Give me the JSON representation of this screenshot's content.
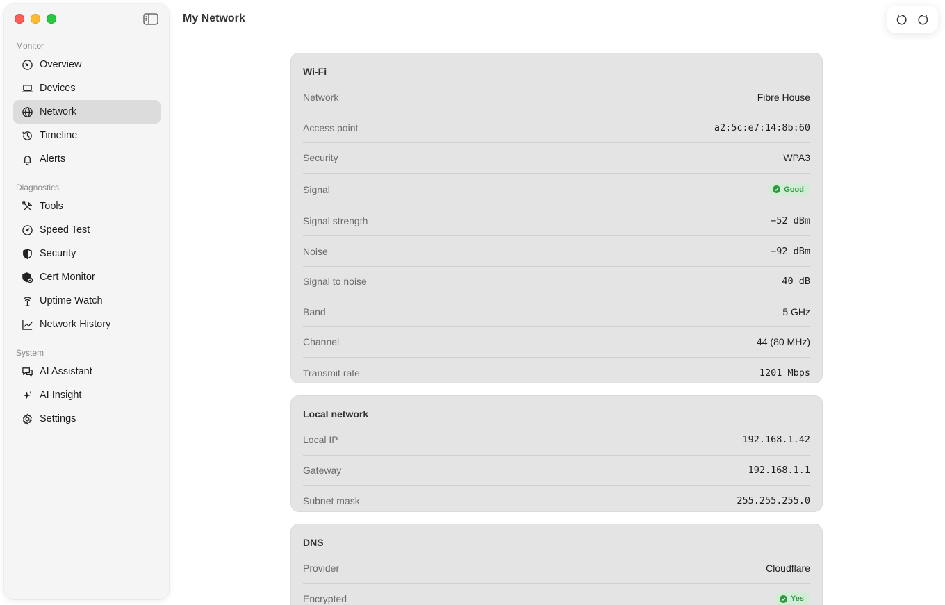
{
  "window": {
    "title": "My Network"
  },
  "sidebar": {
    "sections": [
      {
        "label": "Monitor"
      },
      {
        "label": "Diagnostics"
      },
      {
        "label": "System"
      }
    ],
    "items": [
      {
        "label": "Overview",
        "icon": "gauge-icon"
      },
      {
        "label": "Devices",
        "icon": "laptop-icon"
      },
      {
        "label": "Network",
        "icon": "globe-icon",
        "active": true
      },
      {
        "label": "Timeline",
        "icon": "history-clock-icon"
      },
      {
        "label": "Alerts",
        "icon": "bell-icon"
      },
      {
        "label": "Tools",
        "icon": "tools-icon"
      },
      {
        "label": "Speed Test",
        "icon": "speedometer-icon"
      },
      {
        "label": "Security",
        "icon": "shield-icon"
      },
      {
        "label": "Cert Monitor",
        "icon": "shield-check-icon"
      },
      {
        "label": "Uptime Watch",
        "icon": "antenna-icon"
      },
      {
        "label": "Network History",
        "icon": "line-chart-icon"
      },
      {
        "label": "AI Assistant",
        "icon": "chat-bubbles-icon"
      },
      {
        "label": "AI Insight",
        "icon": "sparkles-icon"
      },
      {
        "label": "Settings",
        "icon": "gear-icon"
      }
    ]
  },
  "wifi": {
    "title": "Wi-Fi",
    "rows": [
      {
        "key": "Network",
        "value": "Fibre House"
      },
      {
        "key": "Access point",
        "value": "a2:5c:e7:14:8b:60"
      },
      {
        "key": "Security",
        "value": "WPA3"
      },
      {
        "key": "Signal",
        "value": "Good"
      },
      {
        "key": "Signal strength",
        "value": "−52 dBm"
      },
      {
        "key": "Noise",
        "value": "−92 dBm"
      },
      {
        "key": "Signal to noise",
        "value": "40 dB"
      },
      {
        "key": "Band",
        "value": "5 GHz"
      },
      {
        "key": "Channel",
        "value": "44 (80 MHz)"
      },
      {
        "key": "Transmit rate",
        "value": "1201 Mbps"
      }
    ]
  },
  "local": {
    "title": "Local network",
    "rows": [
      {
        "key": "Local IP",
        "value": "192.168.1.42"
      },
      {
        "key": "Gateway",
        "value": "192.168.1.1"
      },
      {
        "key": "Subnet mask",
        "value": "255.255.255.0"
      }
    ]
  },
  "dns": {
    "title": "DNS",
    "rows": [
      {
        "key": "Provider",
        "value": "Cloudflare"
      },
      {
        "key": "Encrypted",
        "value": "Yes"
      }
    ]
  },
  "colors": {
    "accent_good": "#2e9a43",
    "badge_bg": "#d3ecd6",
    "sidebar_active": "#dcdcdc"
  }
}
